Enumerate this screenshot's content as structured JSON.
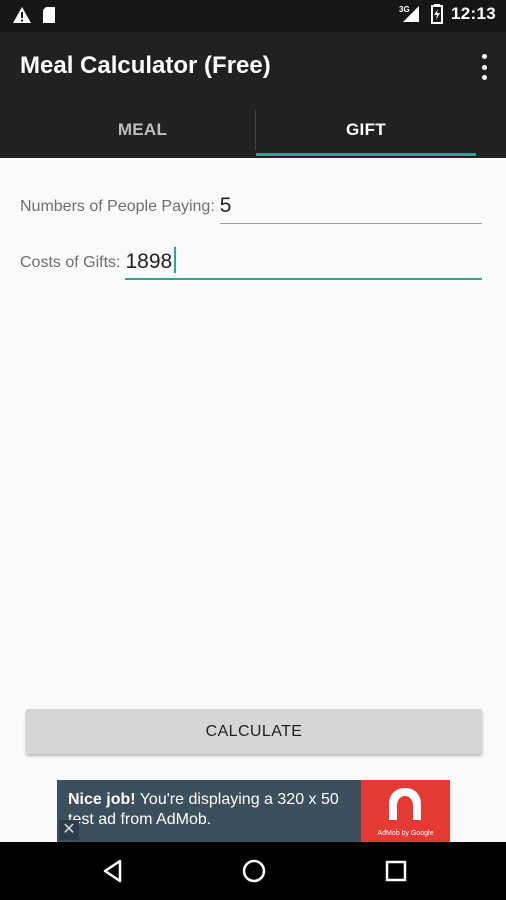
{
  "status_bar": {
    "time": "12:13",
    "network": "3G",
    "icons": [
      "warning-icon",
      "sd-card-icon",
      "signal-icon",
      "battery-icon"
    ]
  },
  "app_bar": {
    "title": "Meal Calculator (Free)",
    "overflow_icon": "more-vert-icon"
  },
  "tabs": [
    {
      "label": "MEAL",
      "selected": false
    },
    {
      "label": "GIFT",
      "selected": true
    }
  ],
  "form": {
    "people_label": "Numbers of People Paying:",
    "people_value": "5",
    "gift_cost_label": "Costs of Gifts:",
    "gift_cost_value": "1898"
  },
  "calculate_label": "CALCULATE",
  "ad": {
    "headline": "Nice job!",
    "body": "You're displaying a 320 x 50 test ad from AdMob.",
    "logo_text": "AdMob by Google",
    "close_symbol": "✕"
  },
  "nav_bar": {
    "icons": [
      "back-icon",
      "home-icon",
      "recents-icon"
    ]
  },
  "colors": {
    "accent": "#26a69a",
    "app_bar": "#212121",
    "ad_background": "#3c4f5c",
    "ad_logo": "#e53935"
  }
}
